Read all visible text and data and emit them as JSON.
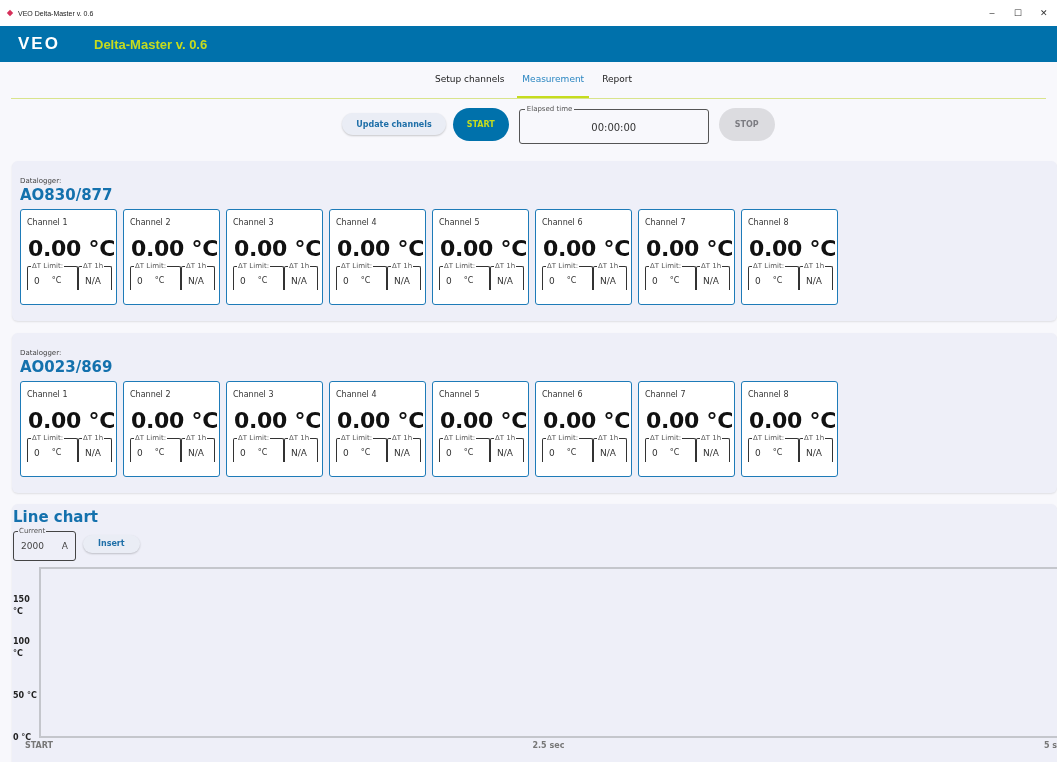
{
  "window": {
    "title": "VEO Delta-Master v. 0.6",
    "controls": [
      "–",
      "☐",
      "✕"
    ]
  },
  "header": {
    "logo": "VEO",
    "title": "Delta-Master v. 0.6"
  },
  "tabs": [
    {
      "label": "Setup channels",
      "selected": false
    },
    {
      "label": "Measurement",
      "selected": true
    },
    {
      "label": "Report",
      "selected": false
    }
  ],
  "controls": {
    "update_button": "Update channels",
    "start_button": {
      "label": "START",
      "disabled": false
    },
    "elapsed": {
      "label": "Elapsed time",
      "value": "00:00:00"
    },
    "stop_button": {
      "label": "STOP",
      "disabled": true
    }
  },
  "dataloggers": [
    {
      "label": "Datalogger:",
      "name": "AO830/877",
      "channels": [
        {
          "name": "Channel 1",
          "value": "0.00 °C",
          "limit_label": "ΔT Limit:",
          "limit": "0",
          "limit_unit": "°C",
          "delta_label": "ΔT 1h",
          "delta": "N/A"
        },
        {
          "name": "Channel 2",
          "value": "0.00 °C",
          "limit_label": "ΔT Limit:",
          "limit": "0",
          "limit_unit": "°C",
          "delta_label": "ΔT 1h",
          "delta": "N/A"
        },
        {
          "name": "Channel 3",
          "value": "0.00 °C",
          "limit_label": "ΔT Limit:",
          "limit": "0",
          "limit_unit": "°C",
          "delta_label": "ΔT 1h",
          "delta": "N/A"
        },
        {
          "name": "Channel 4",
          "value": "0.00 °C",
          "limit_label": "ΔT Limit:",
          "limit": "0",
          "limit_unit": "°C",
          "delta_label": "ΔT 1h",
          "delta": "N/A"
        },
        {
          "name": "Channel 5",
          "value": "0.00 °C",
          "limit_label": "ΔT Limit:",
          "limit": "0",
          "limit_unit": "°C",
          "delta_label": "ΔT 1h",
          "delta": "N/A"
        },
        {
          "name": "Channel 6",
          "value": "0.00 °C",
          "limit_label": "ΔT Limit:",
          "limit": "0",
          "limit_unit": "°C",
          "delta_label": "ΔT 1h",
          "delta": "N/A"
        },
        {
          "name": "Channel 7",
          "value": "0.00 °C",
          "limit_label": "ΔT Limit:",
          "limit": "0",
          "limit_unit": "°C",
          "delta_label": "ΔT 1h",
          "delta": "N/A"
        },
        {
          "name": "Channel 8",
          "value": "0.00 °C",
          "limit_label": "ΔT Limit:",
          "limit": "0",
          "limit_unit": "°C",
          "delta_label": "ΔT 1h",
          "delta": "N/A"
        }
      ]
    },
    {
      "label": "Datalogger:",
      "name": "AO023/869",
      "channels": [
        {
          "name": "Channel 1",
          "value": "0.00 °C",
          "limit_label": "ΔT Limit:",
          "limit": "0",
          "limit_unit": "°C",
          "delta_label": "ΔT 1h",
          "delta": "N/A"
        },
        {
          "name": "Channel 2",
          "value": "0.00 °C",
          "limit_label": "ΔT Limit:",
          "limit": "0",
          "limit_unit": "°C",
          "delta_label": "ΔT 1h",
          "delta": "N/A"
        },
        {
          "name": "Channel 3",
          "value": "0.00 °C",
          "limit_label": "ΔT Limit:",
          "limit": "0",
          "limit_unit": "°C",
          "delta_label": "ΔT 1h",
          "delta": "N/A"
        },
        {
          "name": "Channel 4",
          "value": "0.00 °C",
          "limit_label": "ΔT Limit:",
          "limit": "0",
          "limit_unit": "°C",
          "delta_label": "ΔT 1h",
          "delta": "N/A"
        },
        {
          "name": "Channel 5",
          "value": "0.00 °C",
          "limit_label": "ΔT Limit:",
          "limit": "0",
          "limit_unit": "°C",
          "delta_label": "ΔT 1h",
          "delta": "N/A"
        },
        {
          "name": "Channel 6",
          "value": "0.00 °C",
          "limit_label": "ΔT Limit:",
          "limit": "0",
          "limit_unit": "°C",
          "delta_label": "ΔT 1h",
          "delta": "N/A"
        },
        {
          "name": "Channel 7",
          "value": "0.00 °C",
          "limit_label": "ΔT Limit:",
          "limit": "0",
          "limit_unit": "°C",
          "delta_label": "ΔT 1h",
          "delta": "N/A"
        },
        {
          "name": "Channel 8",
          "value": "0.00 °C",
          "limit_label": "ΔT Limit:",
          "limit": "0",
          "limit_unit": "°C",
          "delta_label": "ΔT 1h",
          "delta": "N/A"
        }
      ]
    }
  ],
  "line_chart": {
    "title": "Line chart",
    "current": {
      "label": "Current",
      "value": "2000",
      "unit": "A"
    },
    "insert_button": "Insert",
    "y_labels": [
      "150 °C",
      "100 °C",
      "50 °C",
      "0 °C"
    ],
    "x_labels": [
      "START",
      "2.5 sec",
      "5 s"
    ]
  }
}
